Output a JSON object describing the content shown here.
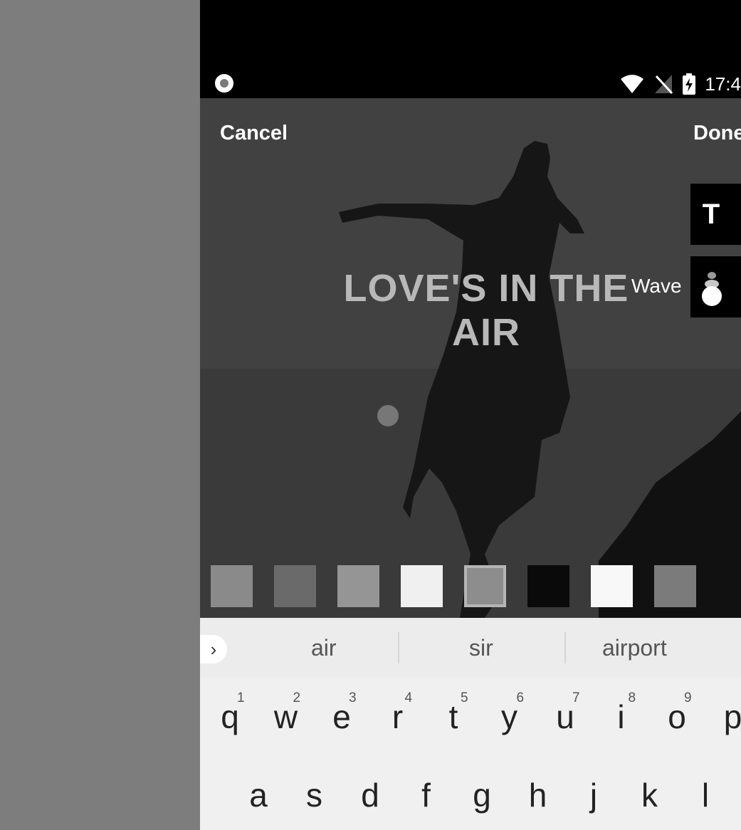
{
  "status_bar": {
    "time": "17:4"
  },
  "editor": {
    "cancel_label": "Cancel",
    "done_label": "Done",
    "font_button_label": "T",
    "animation_label": "Wave",
    "overlay_text_line1": "LOVE'S IN THE",
    "overlay_text_line2": "AIR"
  },
  "swatches": [
    "#8a8a8a",
    "#6a6a6a",
    "#959595",
    "#f0f0f0",
    "#8d8d8d",
    "#0a0a0a",
    "#f8f8f8",
    "#7b7b7b"
  ],
  "suggestions": [
    "air",
    "sir",
    "airport"
  ],
  "keyboard": {
    "row1": [
      {
        "letter": "q",
        "hint": "1"
      },
      {
        "letter": "w",
        "hint": "2"
      },
      {
        "letter": "e",
        "hint": "3"
      },
      {
        "letter": "r",
        "hint": "4"
      },
      {
        "letter": "t",
        "hint": "5"
      },
      {
        "letter": "y",
        "hint": "6"
      },
      {
        "letter": "u",
        "hint": "7"
      },
      {
        "letter": "i",
        "hint": "8"
      },
      {
        "letter": "o",
        "hint": "9"
      },
      {
        "letter": "p",
        "hint": ""
      }
    ],
    "row2": [
      "a",
      "s",
      "d",
      "f",
      "g",
      "h",
      "j",
      "k",
      "l"
    ]
  }
}
